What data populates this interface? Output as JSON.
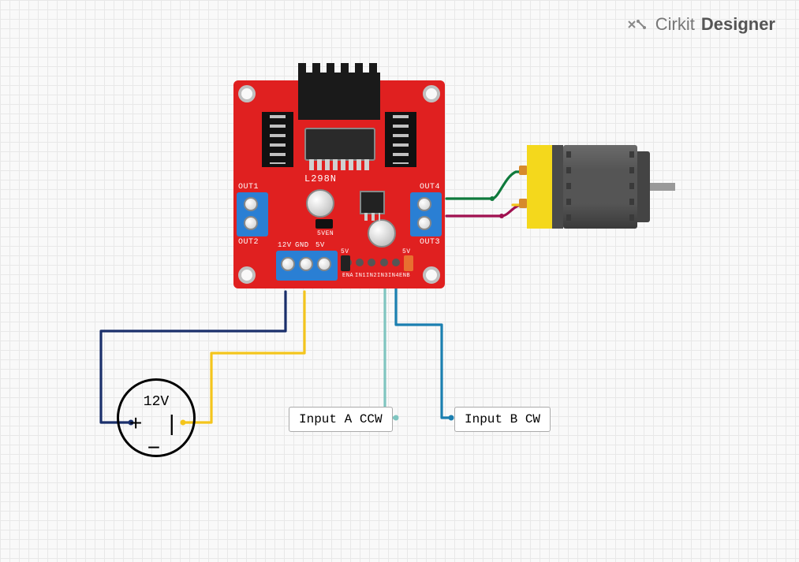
{
  "logo": {
    "text1": "Cirkit",
    "text2": "Designer"
  },
  "board": {
    "chip_label": "L298N",
    "out1": "OUT1",
    "out2": "OUT2",
    "out3": "OUT3",
    "out4": "OUT4",
    "p12v": "12V",
    "pgnd": "GND",
    "p5v": "5V",
    "ena": "ENA",
    "in1": "IN1",
    "in2": "IN2",
    "in3": "IN3",
    "in4": "IN4",
    "enb": "ENB",
    "fiveven": "5VEN",
    "small5v": "5V",
    "small5v2": "5V"
  },
  "battery": {
    "voltage": "12V",
    "symbols": "+ | −"
  },
  "labels": {
    "inputA": "Input A CCW",
    "inputB": "Input B CW"
  },
  "colors": {
    "wire_navy": "#1a2f6b",
    "wire_yellow": "#f4c51c",
    "wire_green": "#0f7a3c",
    "wire_magenta": "#a01050",
    "wire_teal": "#7fc5c0",
    "wire_blue": "#1b7fb0"
  },
  "chart_data": {
    "type": "diagram",
    "components": [
      {
        "name": "L298N Motor Driver",
        "role": "H-bridge driver"
      },
      {
        "name": "DC Motor",
        "role": "load"
      },
      {
        "name": "12V Battery",
        "role": "power supply"
      },
      {
        "name": "Input A CCW",
        "role": "control signal IN3"
      },
      {
        "name": "Input B CW",
        "role": "control signal IN4"
      }
    ],
    "connections": [
      {
        "from": "Battery +",
        "to": "L298N 12V",
        "color": "navy"
      },
      {
        "from": "Battery -",
        "to": "L298N GND",
        "color": "yellow"
      },
      {
        "from": "L298N OUT4",
        "to": "Motor lug top",
        "color": "green"
      },
      {
        "from": "L298N OUT3",
        "to": "Motor lug bottom",
        "color": "magenta"
      },
      {
        "from": "Input A CCW",
        "to": "L298N IN3",
        "color": "teal"
      },
      {
        "from": "Input B CW",
        "to": "L298N IN4",
        "color": "blue"
      }
    ]
  }
}
